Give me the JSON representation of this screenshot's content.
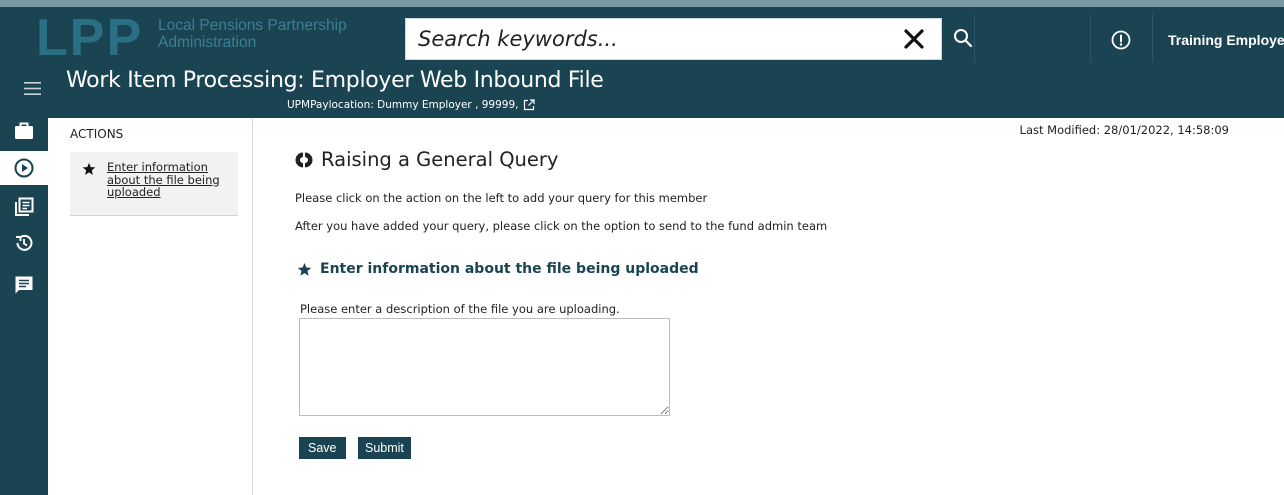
{
  "header": {
    "logo_letters": "LPP",
    "logo_line1": "Local Pensions Partnership",
    "logo_line2": "Administration",
    "search": {
      "placeholder": "Search keywords...",
      "value": ""
    },
    "user_name": "Training Employer",
    "icons": {
      "clear": "close-icon",
      "search": "search-icon",
      "alert": "alert-circle-icon"
    }
  },
  "titlebar": {
    "title": "Work Item Processing: Employer Web Inbound File",
    "subtitle": "UPMPaylocation: Dummy Employer , 99999,"
  },
  "leftnav": {
    "items": [
      {
        "icon": "briefcase-icon"
      },
      {
        "icon": "play-circle-icon",
        "active": true
      },
      {
        "icon": "documents-icon"
      },
      {
        "icon": "history-icon"
      },
      {
        "icon": "message-icon"
      }
    ]
  },
  "actions": {
    "title": "ACTIONS",
    "items": [
      {
        "icon": "star-icon",
        "label": "Enter information about the file being uploaded"
      }
    ]
  },
  "main": {
    "last_modified": "Last Modified: 28/01/2022, 14:58:09",
    "section_title": "Raising a General Query",
    "para1": "Please click on the action on the left to add your query for this member",
    "para2": "After you have added your query, please click on the option to send to the fund admin team",
    "form_heading": "Enter information about the file being uploaded",
    "description_label": "Please enter a description of the file you are uploading.",
    "description_value": "",
    "save_label": "Save",
    "submit_label": "Submit"
  },
  "colors": {
    "header_bg": "#1a4452",
    "header_top_strip": "#7a9aa5",
    "logo": "#2b6f84",
    "accent_text": "#1a4452"
  }
}
